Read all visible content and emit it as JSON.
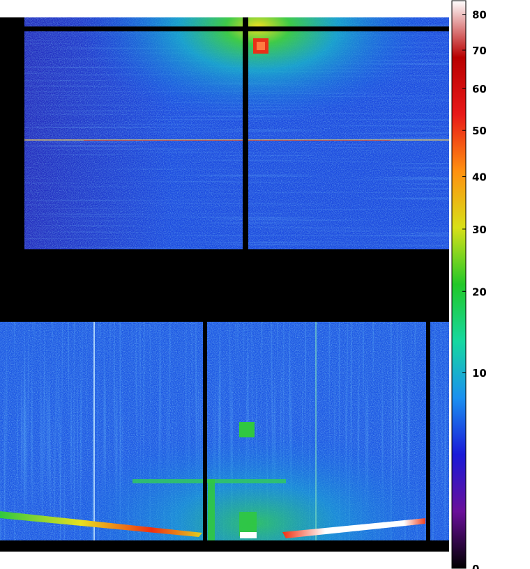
{
  "chart_data": {
    "type": "heatmap",
    "title": "",
    "xlabel": "",
    "ylabel": "",
    "colorbar": {
      "scale": "sqrt",
      "range": [
        0,
        84
      ],
      "ticks": [
        {
          "value": 0,
          "label": "0"
        },
        {
          "value": 10,
          "label": "10"
        },
        {
          "value": 20,
          "label": "20"
        },
        {
          "value": 30,
          "label": "30"
        },
        {
          "value": 40,
          "label": "40"
        },
        {
          "value": 50,
          "label": "50"
        },
        {
          "value": 60,
          "label": "60"
        },
        {
          "value": 70,
          "label": "70"
        },
        {
          "value": 80,
          "label": "80"
        }
      ],
      "colors": [
        "#000000",
        "#6a0f9a",
        "#1a1ad8",
        "#1a90f0",
        "#16d8a0",
        "#22c828",
        "#d8e018",
        "#ff9010",
        "#e81818",
        "#b80000",
        "#ffffff"
      ]
    },
    "panels": [
      {
        "name": "upper",
        "background_level": 6,
        "hot_spot_level": 72,
        "glow_level": 28
      },
      {
        "name": "lower",
        "background_level": 7,
        "streak_level": 78,
        "glow_level": 16
      }
    ]
  }
}
